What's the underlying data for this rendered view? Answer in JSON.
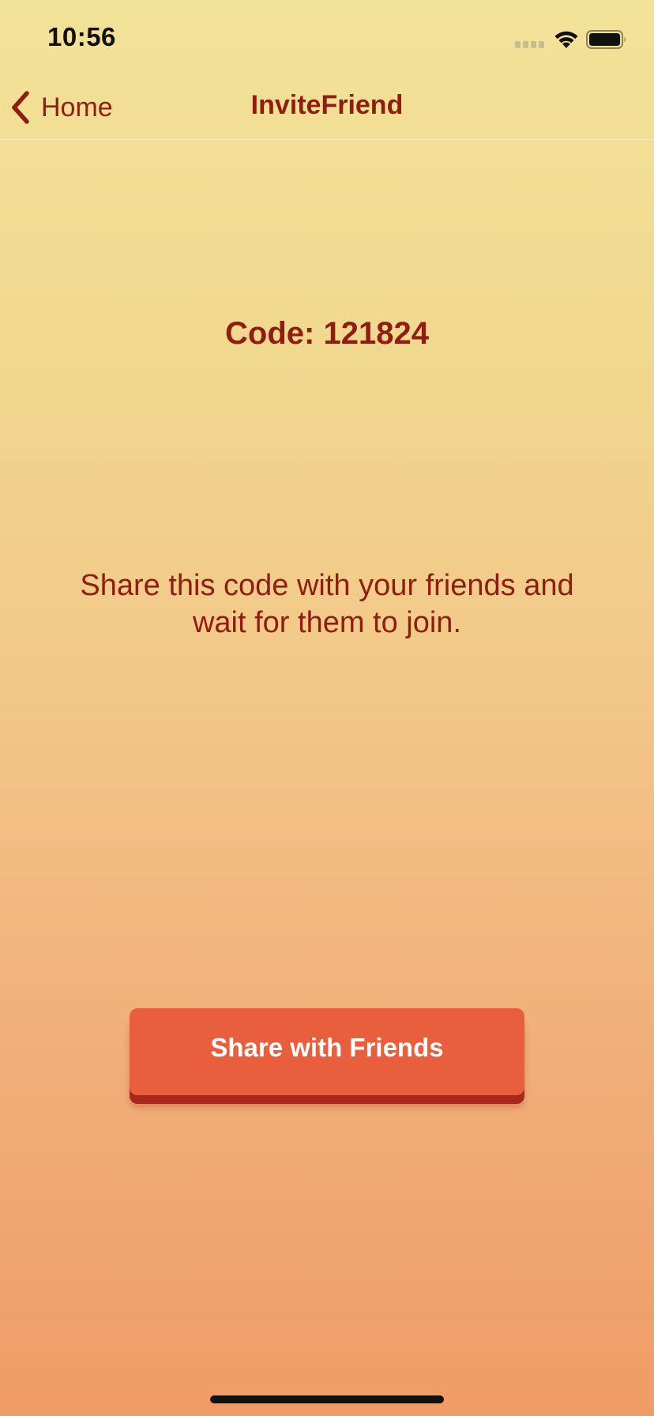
{
  "status_bar": {
    "time": "10:56",
    "icons": [
      "signal-icon",
      "wifi-icon",
      "battery-icon"
    ]
  },
  "nav_bar": {
    "back_label": "Home",
    "back_icon": "chevron-left-icon",
    "title": "InviteFriend"
  },
  "content": {
    "code_text": "Code: 121824",
    "instructions": "Share this code with your friends and wait for them to join."
  },
  "share_button": {
    "label": "Share with Friends"
  },
  "colors": {
    "accent_text": "#8f1d12",
    "button": "#e95e3c",
    "button_shadow": "#a8281a",
    "gradient_top": "#f2e298",
    "gradient_bottom": "#f09c66"
  }
}
